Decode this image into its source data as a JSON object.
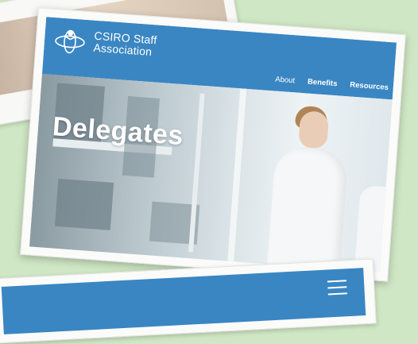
{
  "site": {
    "brand_line1": "CSIRO Staff",
    "brand_line2": "Association",
    "nav": [
      "About",
      "Benefits",
      "Resources"
    ],
    "hero_title": "Delegates"
  },
  "colors": {
    "header_blue": "#3a86c3",
    "background_green": "#cfe7c4"
  },
  "icons": {
    "logo": "csiro-logo-icon",
    "menu": "hamburger-menu-icon"
  }
}
